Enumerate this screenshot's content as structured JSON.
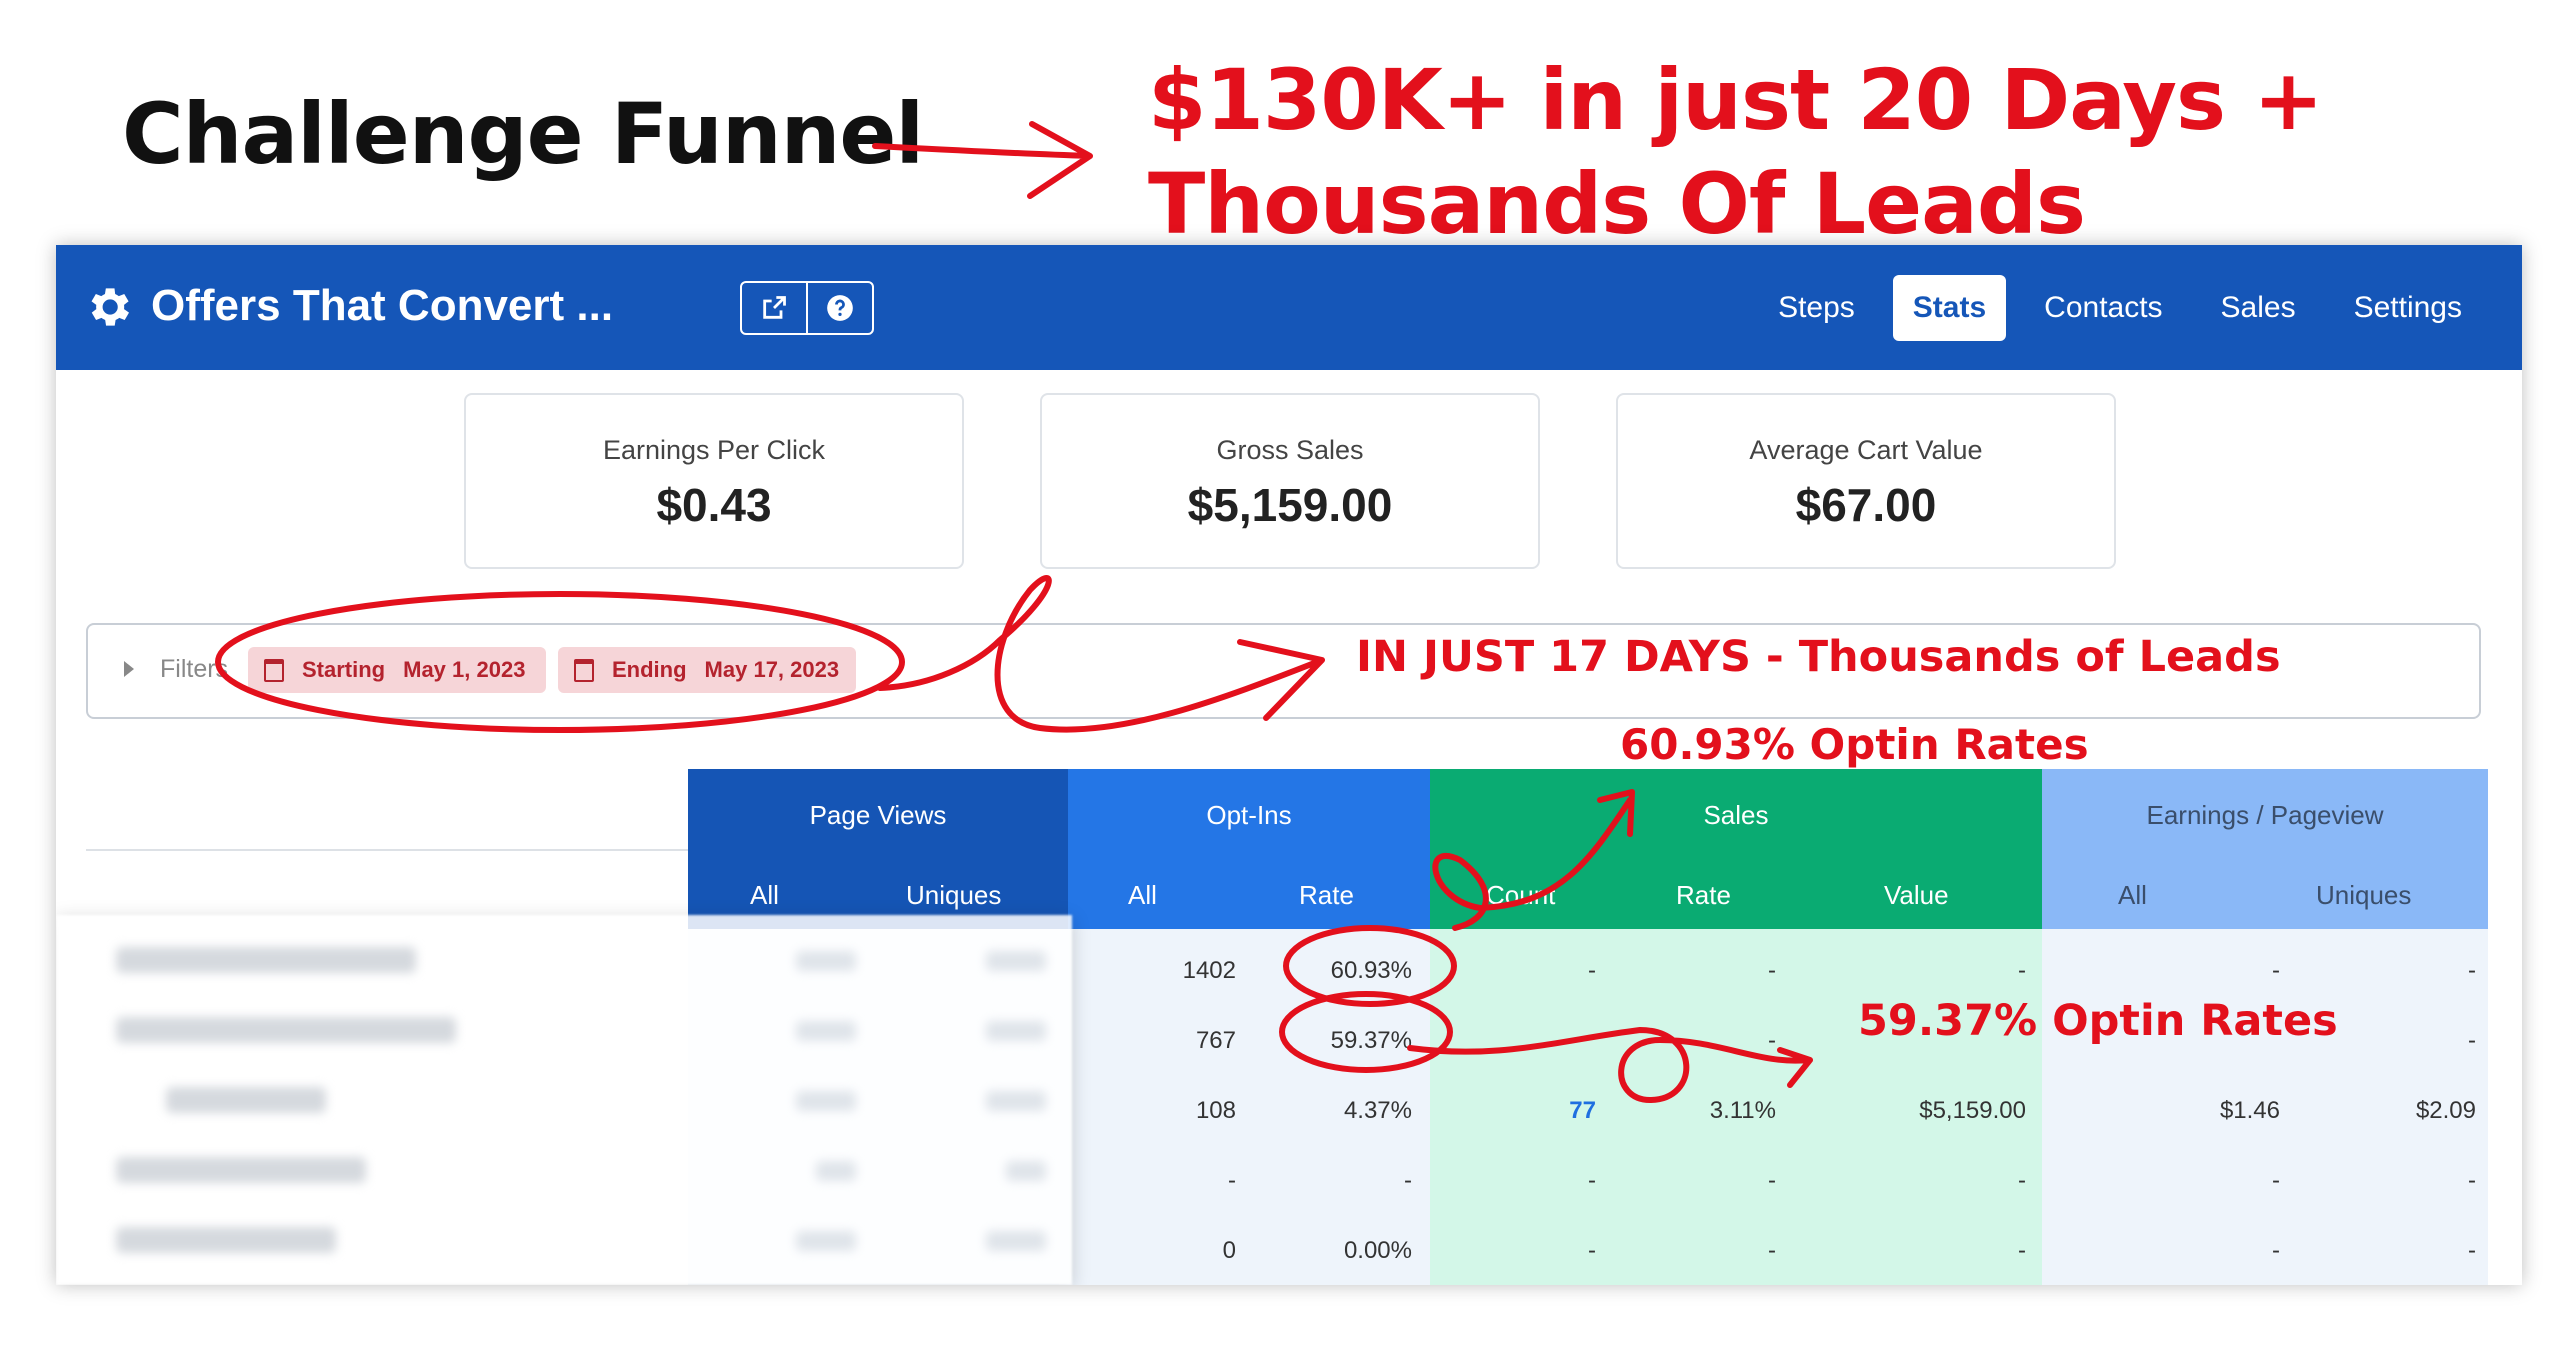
{
  "headline": {
    "left": "Challenge Funnel",
    "right": "$130K+ in just 20 Days + Thousands Of Leads"
  },
  "app": {
    "title": "Offers That Convert ...",
    "icons": [
      "gear-icon",
      "external-edit-icon",
      "help-icon"
    ],
    "nav": [
      {
        "label": "Steps",
        "active": false
      },
      {
        "label": "Stats",
        "active": true
      },
      {
        "label": "Contacts",
        "active": false
      },
      {
        "label": "Sales",
        "active": false
      },
      {
        "label": "Settings",
        "active": false
      }
    ]
  },
  "summary": [
    {
      "label": "Earnings Per Click",
      "value": "$0.43"
    },
    {
      "label": "Gross Sales",
      "value": "$5,159.00"
    },
    {
      "label": "Average Cart Value",
      "value": "$67.00"
    }
  ],
  "filters": {
    "label": "Filters",
    "starting_label": "Starting",
    "starting_date": "May 1, 2023",
    "ending_label": "Ending",
    "ending_date": "May 17, 2023"
  },
  "table": {
    "groups": [
      "Page Views",
      "Opt-Ins",
      "Sales",
      "Earnings / Pageview"
    ],
    "subheaders": [
      "All",
      "Uniques",
      "All",
      "Rate",
      "Count",
      "Rate",
      "Value",
      "All",
      "Uniques"
    ],
    "rows": [
      [
        "1402",
        "60.93%",
        "-",
        "-",
        "-",
        "-",
        "-"
      ],
      [
        "767",
        "59.37%",
        "",
        "-",
        "",
        "",
        "-"
      ],
      [
        "108",
        "4.37%",
        "77",
        "3.11%",
        "$5,159.00",
        "$1.46",
        "$2.09"
      ],
      [
        "-",
        "-",
        "-",
        "-",
        "-",
        "-",
        "-"
      ],
      [
        "0",
        "0.00%",
        "-",
        "-",
        "-",
        "-",
        "-"
      ]
    ]
  },
  "annotations": {
    "days": "IN JUST 17 DAYS - Thousands of Leads",
    "optin1": "60.93% Optin Rates",
    "optin2": "59.37% Optin Rates"
  },
  "colors": {
    "topbar": "#1556b8",
    "page_views": "#1555b5",
    "opt_ins": "#2476e6",
    "sales": "#0aab72",
    "earnings": "#8ab8f7",
    "annotation": "#e3101c"
  }
}
